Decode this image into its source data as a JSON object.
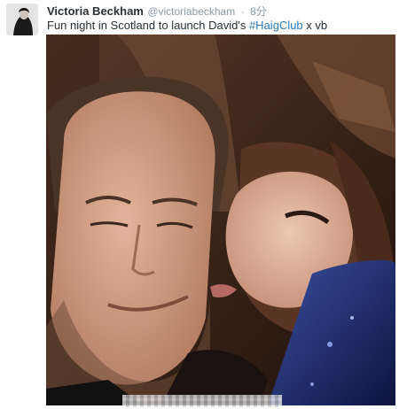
{
  "tweet": {
    "author_name": "Victoria Beckham",
    "author_handle": "@victoriabeckham",
    "separator": "·",
    "time": "8分",
    "text_before": "Fun night in Scotland to launch David's ",
    "hashtag": "#HaigClub",
    "text_after": " x vb"
  },
  "colors": {
    "name": "#292f33",
    "meta": "#8899a6",
    "hashtag": "#2b7bb9"
  }
}
